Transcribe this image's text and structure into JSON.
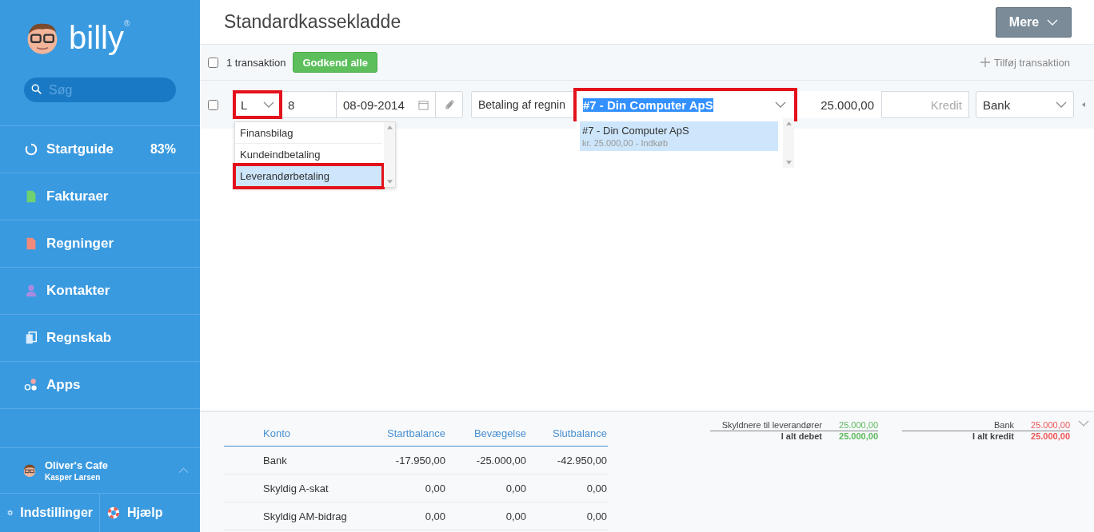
{
  "sidebar": {
    "logo": {
      "text": "billy",
      "mark": "®"
    },
    "search": {
      "placeholder": "Søg"
    },
    "items": [
      {
        "kind": "progress",
        "label": "Startguide",
        "badge": "83%"
      },
      {
        "kind": "invoice",
        "label": "Fakturaer"
      },
      {
        "kind": "bill",
        "label": "Regninger"
      },
      {
        "kind": "contact",
        "label": "Kontakter"
      },
      {
        "kind": "accounting",
        "label": "Regnskab"
      },
      {
        "kind": "apps",
        "label": "Apps"
      }
    ],
    "company": {
      "name": "Oliver's Cafe",
      "user": "Kasper Larsen"
    },
    "footer": [
      {
        "kind": "settings",
        "label": "Indstillinger"
      },
      {
        "kind": "help",
        "label": "Hjælp"
      }
    ]
  },
  "header": {
    "title": "Standardkassekladde",
    "menu_button": "Mere"
  },
  "toolbar": {
    "checked": false,
    "count": "1 transaktion",
    "approve_button": "Godkend alle",
    "add_link": "Tilføj transaktion"
  },
  "transaction": {
    "checked": false,
    "type": {
      "value": "L",
      "highlighted": true,
      "options": [
        {
          "label": "Finansbilag",
          "selected": false,
          "highlighted": false
        },
        {
          "label": "Kundeindbetaling",
          "selected": false,
          "highlighted": false
        },
        {
          "label": "Leverandørbetaling",
          "selected": true,
          "highlighted": true
        }
      ]
    },
    "number": "8",
    "date": "08-09-2014",
    "description": "Betaling af regnin",
    "invoice": {
      "value": "#7 - Din Computer ApS",
      "highlighted": true,
      "options": [
        {
          "title": "#7 - Din Computer ApS",
          "subtitle": "kr. 25.000,00 - Indkøb",
          "selected": true
        }
      ]
    },
    "debit": "25.000,00",
    "credit": {
      "placeholder": "Kredit"
    },
    "account": "Bank"
  },
  "balance_table": {
    "columns": [
      "Konto",
      "Startbalance",
      "Bevægelse",
      "Slutbalance"
    ],
    "rows": [
      [
        "Bank",
        "-17.950,00",
        "-25.000,00",
        "-42.950,00"
      ],
      [
        "Skyldig A-skat",
        "0,00",
        "0,00",
        "0,00"
      ],
      [
        "Skyldig AM-bidrag",
        "0,00",
        "0,00",
        "0,00"
      ]
    ]
  },
  "summary": {
    "debit": {
      "lines": [
        {
          "label": "Skyldnere til leverandører",
          "amount": "25.000,00"
        }
      ],
      "total_label": "I alt debet",
      "total": "25.000,00"
    },
    "credit": {
      "lines": [
        {
          "label": "Bank",
          "amount": "25.000,00"
        }
      ],
      "total_label": "I alt kredit",
      "total": "25.000,00"
    }
  }
}
